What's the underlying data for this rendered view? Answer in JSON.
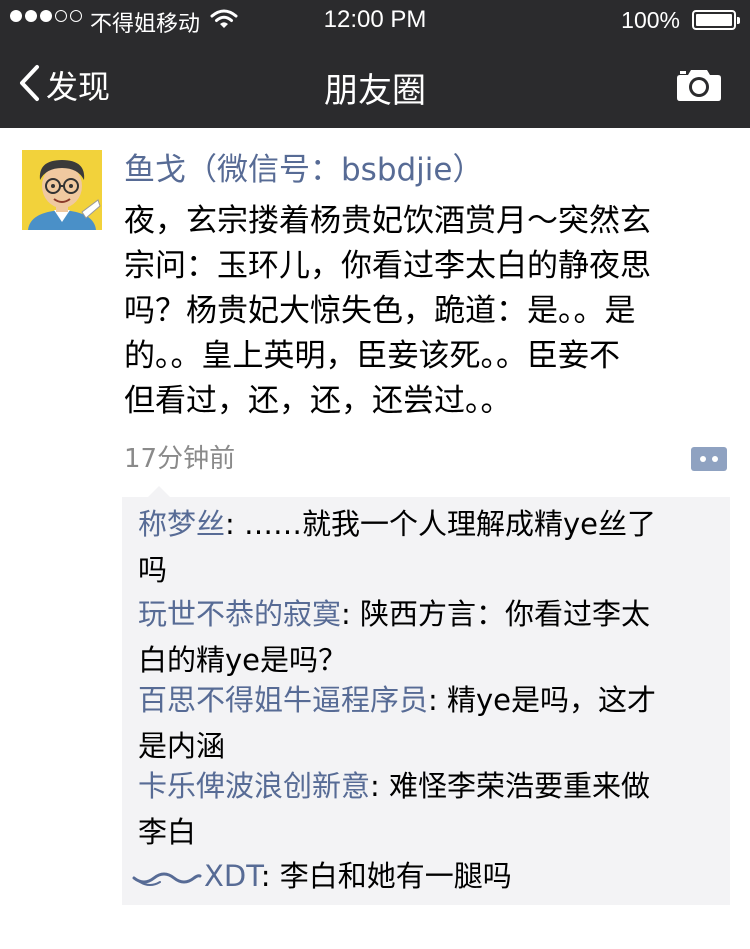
{
  "status_bar": {
    "carrier": "不得姐移动",
    "time": "12:00 PM",
    "battery_percent": "100%",
    "battery_level": 1.0,
    "signal_bars": 3,
    "signal_max": 5
  },
  "nav": {
    "back_label": "发现",
    "title": "朋友圈",
    "back_icon": "chevron-left-icon",
    "right_icon": "camera-icon"
  },
  "post": {
    "author": "鱼戈（微信号：bsbdjie）",
    "content_lines": [
      "夜，玄宗搂着杨贵妃饮酒赏月～突然玄",
      "宗问：玉环儿，你看过李太白的静夜思",
      "吗？杨贵妃大惊失色，跪道：是。。是",
      "的。。皇上英明，臣妾该死。。臣妾不",
      "但看过，还，还，还尝过。。"
    ],
    "time_ago": "17分钟前"
  },
  "comments": [
    {
      "name": "称梦丝",
      "lines": [
        ": ……就我一个人理解成精ye丝了",
        "吗"
      ]
    },
    {
      "name": "玩世不恭的寂寞",
      "lines": [
        ": 陕西方言：你看过李太",
        "白的精ye是吗？"
      ]
    },
    {
      "name": "百思不得姐牛逼程序员",
      "lines": [
        ": 精ye是吗，这才",
        "是内涵"
      ]
    },
    {
      "name": "卡乐俾波浪创新意",
      "lines": [
        ": 难怪李荣浩要重来做",
        "李白"
      ]
    },
    {
      "name": "XDT",
      "lines": [
        ": 李白和她有一腿吗"
      ]
    }
  ],
  "colors": {
    "bar_background": "#2b2b2d",
    "link_blue": "#576b95",
    "comment_background": "#f3f3f5",
    "timestamp_gray": "#8a8a8a"
  }
}
